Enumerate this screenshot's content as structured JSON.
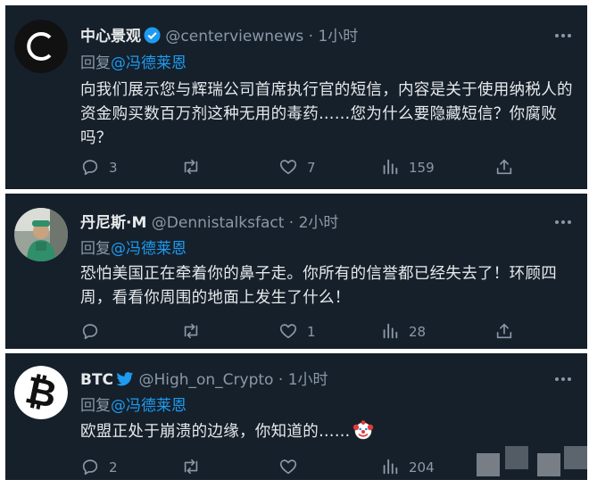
{
  "icons": {
    "reply": "speech-bubble-icon",
    "retweet": "retweet-icon",
    "like": "heart-icon",
    "views": "bar-chart-icon",
    "share": "share-upload-icon",
    "more": "three-dots-icon"
  },
  "colors": {
    "background": "#15202b",
    "text": "#e7e9ea",
    "muted": "#8b98a5",
    "link": "#1d9bf0"
  },
  "tweets": [
    {
      "name": "中心景观",
      "handle": "@centerviewnews",
      "dot": "·",
      "time": "1小时",
      "reply_prefix": "回复",
      "reply_to": "@冯德莱恩",
      "text": "向我们展示您与辉瑞公司首席执行官的短信，内容是关于使用纳税人的资金购买数百万剂这种无用的毒药……您为什么要隐藏短信？你腐败吗？",
      "reply_count": "3",
      "retweet_count": "",
      "like_count": "7",
      "view_count": "159"
    },
    {
      "name": "丹尼斯·M",
      "handle": "@Dennistalksfact",
      "dot": "·",
      "time": "2小时",
      "reply_prefix": "回复",
      "reply_to": "@冯德莱恩",
      "text": "恐怕美国正在牵着你的鼻子走。你所有的信誉都已经失去了！环顾四周，看看你周围的地面上发生了什么！",
      "reply_count": "",
      "retweet_count": "",
      "like_count": "1",
      "view_count": "28"
    },
    {
      "name": "BTC",
      "handle": "@High_on_Crypto",
      "dot": "·",
      "time": "1小时",
      "reply_prefix": "回复",
      "reply_to": "@冯德莱恩",
      "text": "欧盟正处于崩溃的边缘，你知道的……",
      "reply_count": "2",
      "retweet_count": "",
      "like_count": "",
      "view_count": "204"
    }
  ]
}
